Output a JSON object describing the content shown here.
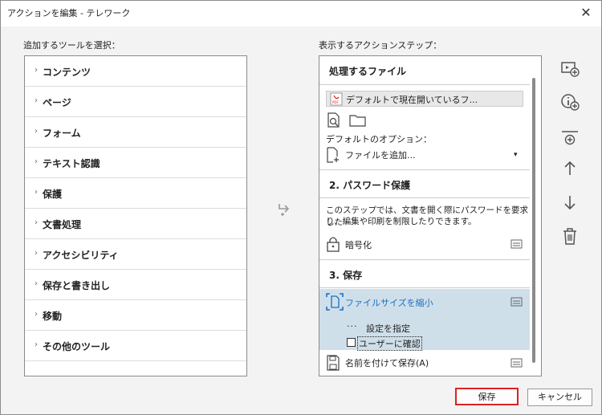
{
  "window": {
    "title": "アクションを編集 - テレワーク",
    "close": "✕"
  },
  "left": {
    "label": "追加するツールを選択：",
    "items": [
      "コンテンツ",
      "ページ",
      "フォーム",
      "テキスト認識",
      "保護",
      "文書処理",
      "アクセシビリティ",
      "保存と書き出し",
      "移動",
      "その他のツール"
    ]
  },
  "right": {
    "label": "表示するアクションステップ：",
    "section1": {
      "title": "処理するファイル",
      "file": "デフォルトで現在開いているフ...",
      "option_label": "デフォルトのオプション：",
      "option_value": "ファイルを追加..."
    },
    "section2": {
      "title": "2. パスワード保護",
      "desc1": "このステップでは、文書を開く際にパスワードを要求した",
      "desc2": "り、編集や印刷を制限したりできます。",
      "step": "暗号化"
    },
    "section3": {
      "title": "3. 保存",
      "step_selected": "ファイルサイズを縮小",
      "settings": "設定を指定",
      "confirm": "ユーザーに確認",
      "save_as": "名前を付けて保存(A)"
    }
  },
  "buttons": {
    "save": "保存",
    "cancel": "キャンセル"
  },
  "colors": {
    "accent": "#1a6fc4",
    "selected_bg": "#cfdfea",
    "save_outline": "#e02020"
  }
}
